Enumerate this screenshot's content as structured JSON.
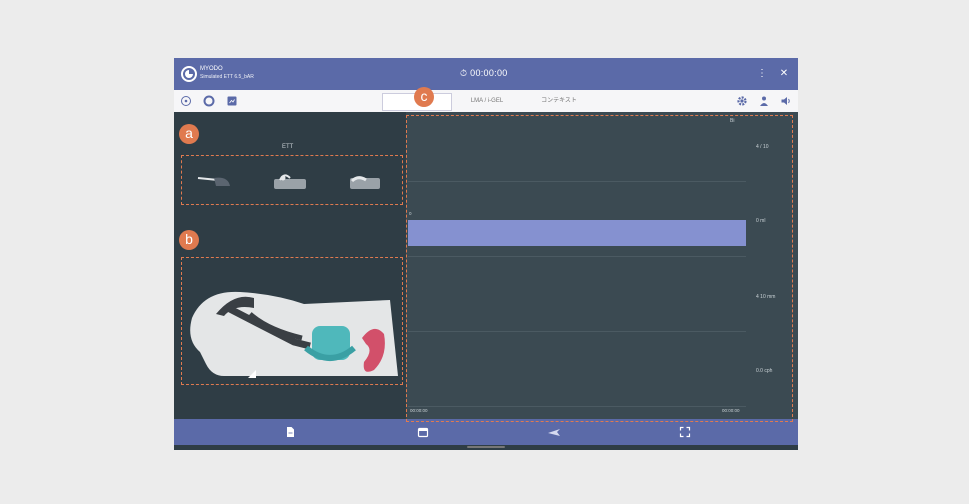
{
  "titlebar": {
    "app_name": "MYODO",
    "subtitle": "Simulated ETT 6.5_bAR",
    "timer": "00:00:00",
    "menu_icon": "more-vert-icon",
    "close_icon": "close-icon",
    "brand_color": "#5b6aa8"
  },
  "toolbar": {
    "tools": [
      "circle-icon",
      "circle-ring-icon",
      "monitor-icon"
    ],
    "tabs": [
      "",
      "LMA / i-GEL",
      "コンテキスト"
    ],
    "right_icons": [
      "gear-icon",
      "person-icon",
      "volume-icon"
    ]
  },
  "left_panel": {
    "ett_label": "ETT",
    "airway_options": [
      "tube-icon",
      "mask-icon",
      "headgear-icon"
    ]
  },
  "chart": {
    "series_color": "#8591d0",
    "y_labels": [
      "4 / 10",
      "0 ml",
      "4 10 mm",
      "0.0 cph"
    ],
    "x_labels": [
      "00:00:00",
      "00:00:00"
    ],
    "left_mark": "0",
    "corner_label": "Bi"
  },
  "bottom_nav": {
    "items": [
      "document-icon",
      "calendar-icon",
      "airplane-icon",
      "fullscreen-icon"
    ]
  },
  "annotations": {
    "a": "a",
    "b": "b",
    "c": "c",
    "color": "#e07a4f"
  }
}
